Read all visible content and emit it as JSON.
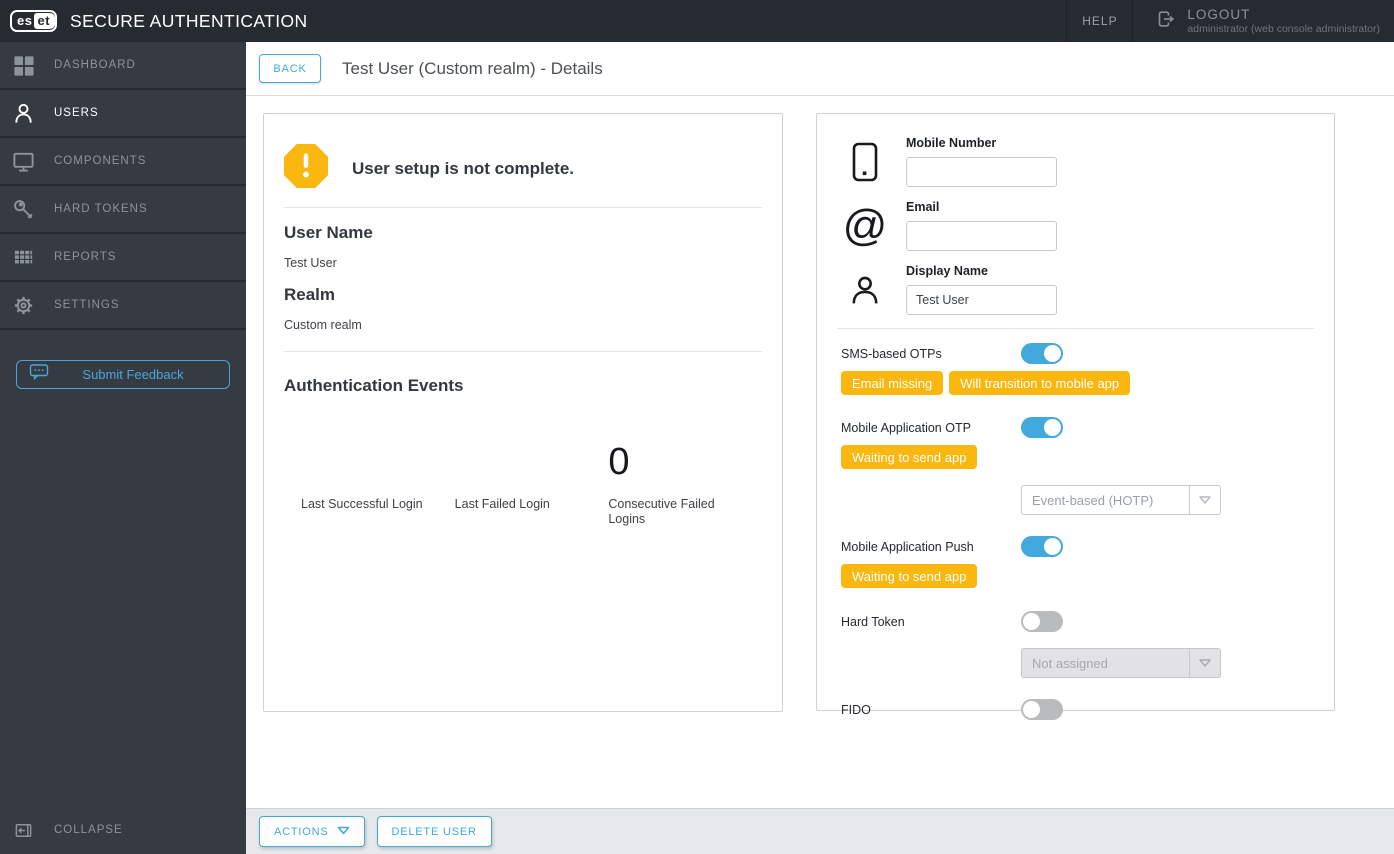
{
  "topbar": {
    "logo_text_left": "es",
    "logo_text_right": "et",
    "brand": "SECURE AUTHENTICATION",
    "help_label": "HELP",
    "logout_label": "LOGOUT",
    "logout_subtitle": "administrator (web console administrator)"
  },
  "sidebar": {
    "items": [
      {
        "label": "DASHBOARD",
        "icon": "dashboard-grid-icon",
        "active": false
      },
      {
        "label": "USERS",
        "icon": "users-person-icon",
        "active": true
      },
      {
        "label": "COMPONENTS",
        "icon": "components-monitor-icon",
        "active": false
      },
      {
        "label": "HARD TOKENS",
        "icon": "hard-tokens-key-icon",
        "active": false
      },
      {
        "label": "REPORTS",
        "icon": "reports-table-icon",
        "active": false
      },
      {
        "label": "SETTINGS",
        "icon": "settings-gear-icon",
        "active": false
      }
    ],
    "feedback_label": "Submit Feedback",
    "collapse_label": "COLLAPSE"
  },
  "header": {
    "back_label": "BACK",
    "title": "Test User (Custom realm) - Details"
  },
  "summary_card": {
    "warning_message": "User setup is not complete.",
    "user_name_label": "User Name",
    "user_name_value": "Test User",
    "realm_label": "Realm",
    "realm_value": "Custom realm",
    "auth_events_title": "Authentication Events",
    "stats": [
      {
        "label": "Last Successful Login",
        "value": ""
      },
      {
        "label": "Last Failed Login",
        "value": ""
      },
      {
        "label": "Consecutive Failed Logins",
        "value": "0"
      }
    ]
  },
  "detail_card": {
    "mobile_number": {
      "label": "Mobile Number",
      "value": "",
      "icon": "phone-icon"
    },
    "email": {
      "label": "Email",
      "value": "",
      "icon": "at-icon"
    },
    "display_name": {
      "label": "Display Name",
      "value": "Test User",
      "icon": "person-icon"
    },
    "methods": {
      "sms": {
        "label": "SMS-based OTPs",
        "enabled": true,
        "badges": [
          "Email missing",
          "Will transition to mobile app"
        ]
      },
      "mobile_otp": {
        "label": "Mobile Application OTP",
        "enabled": true,
        "badges": [
          "Waiting to send app"
        ],
        "otp_type": "Event-based (HOTP)"
      },
      "mobile_push": {
        "label": "Mobile Application Push",
        "enabled": true,
        "badges": [
          "Waiting to send app"
        ]
      },
      "hard_token": {
        "label": "Hard Token",
        "enabled": false,
        "assignment": "Not assigned",
        "assignment_disabled": true
      },
      "fido": {
        "label": "FIDO",
        "enabled": false
      }
    }
  },
  "footer": {
    "actions_label": "ACTIONS",
    "delete_label": "DELETE USER"
  },
  "colors": {
    "accent_blue": "#41a9dc",
    "warning_yellow": "#f9b70f",
    "topbar_bg": "#262b32",
    "sidebar_bg": "#363b43",
    "footer_bg": "#e7e8e9"
  }
}
